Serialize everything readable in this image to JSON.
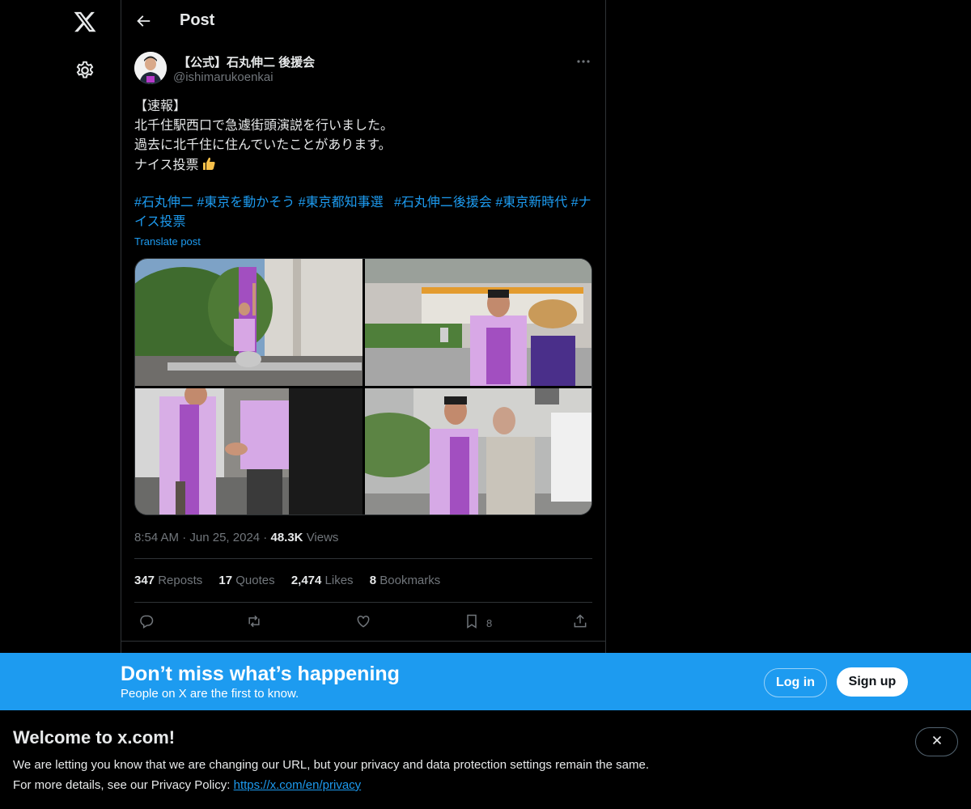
{
  "header": {
    "title": "Post",
    "back_icon": "arrow-left-icon"
  },
  "nav": {
    "logo": "x-logo-icon",
    "settings_icon": "gear-icon"
  },
  "post": {
    "author_name": "【公式】石丸伸二 後援会",
    "author_handle": "@ishimarukoenkai",
    "more_icon": "more-icon",
    "text_lines": [
      "【速報】",
      "北千住駅西口で急遽街頭演説を行いました。",
      "過去に北千住に住んでいたことがあります。",
      "ナイス投票"
    ],
    "hashtags": [
      "#石丸伸二",
      "#東京を動かそう",
      "#東京都知事選",
      "#石丸伸二後援会",
      "#東京新時代",
      "#ナイス投票"
    ],
    "translate_label": "Translate post",
    "time": "8:54 AM",
    "date": "Jun 25, 2024",
    "views_count": "48.3K",
    "views_label": "Views",
    "stats": {
      "reposts_count": "347",
      "reposts_label": "Reposts",
      "quotes_count": "17",
      "quotes_label": "Quotes",
      "likes_count": "2,474",
      "likes_label": "Likes",
      "bookmarks_count": "8",
      "bookmarks_label": "Bookmarks"
    },
    "action_bookmark_count": "8"
  },
  "banner": {
    "title": "Don’t miss what’s happening",
    "subtitle": "People on X are the first to know.",
    "login_label": "Log in",
    "signup_label": "Sign up"
  },
  "welcome": {
    "title": "Welcome to x.com!",
    "line1": "We are letting you know that we are changing our URL, but your privacy and data protection settings remain the same.",
    "line2_prefix": "For more details, see our Privacy Policy:",
    "privacy_link": "https://x.com/en/privacy"
  },
  "colors": {
    "accent": "#1d9bf0",
    "banner": "#1d9bf0",
    "background": "#000000",
    "muted": "#71767b"
  }
}
